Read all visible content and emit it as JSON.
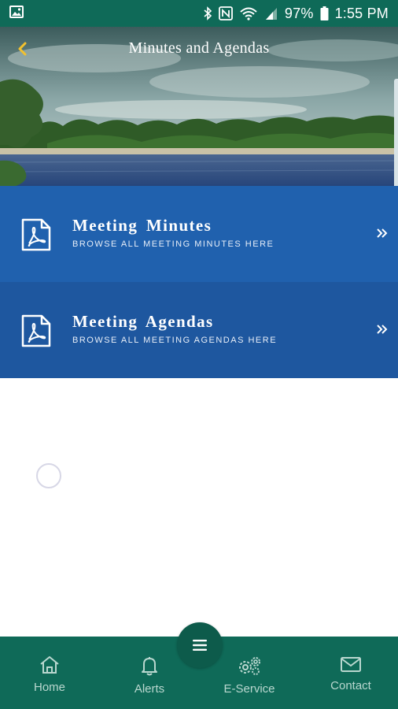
{
  "status_bar": {
    "battery": "97%",
    "time": "1:55 PM"
  },
  "header": {
    "title": "Minutes and Agendas",
    "back_icon": "chevron-left-icon"
  },
  "menu": [
    {
      "title": "Meeting Minutes",
      "subtitle": "BROWSE ALL MEETING MINUTES HERE",
      "icon": "pdf-icon"
    },
    {
      "title": "Meeting Agendas",
      "subtitle": "BROWSE ALL MEETING AGENDAS HERE",
      "icon": "pdf-icon"
    }
  ],
  "bottom_nav": {
    "menu_icon": "hamburger-icon",
    "items": [
      {
        "label": "Home",
        "icon": "home-icon"
      },
      {
        "label": "Alerts",
        "icon": "bell-icon"
      },
      {
        "label": "E-Service",
        "icon": "gears-icon"
      },
      {
        "label": "Contact",
        "icon": "envelope-icon"
      }
    ]
  },
  "colors": {
    "status_bar": "#0f6a58",
    "row_minutes": "#2061ae",
    "row_agendas": "#1e579f",
    "accent_back": "#f2c12e",
    "bottom_nav": "#0f6a58"
  }
}
